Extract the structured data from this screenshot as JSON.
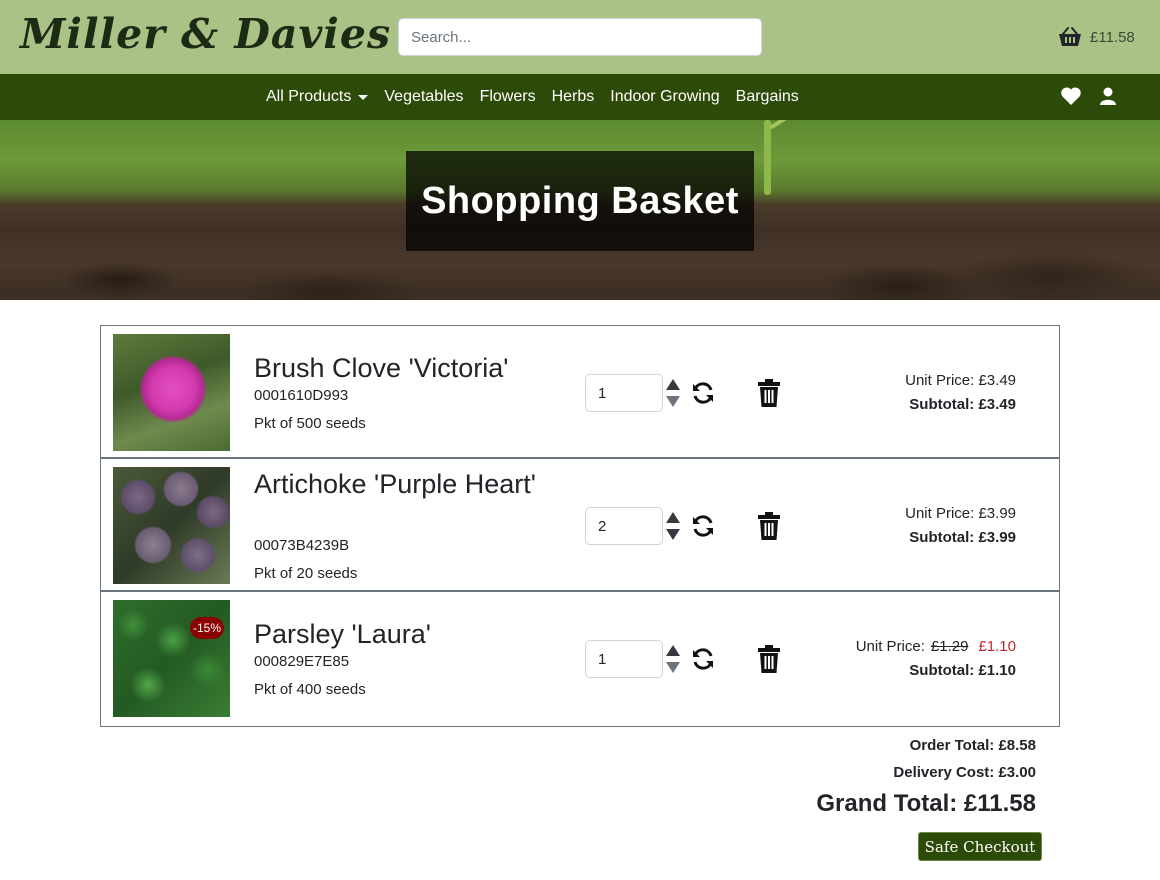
{
  "header": {
    "brand": "Miller & Davies",
    "search_placeholder": "Search...",
    "basket_total": "£11.58",
    "basket_icon": "basket-icon"
  },
  "nav": {
    "items": [
      {
        "label": "All Products",
        "dropdown": true
      },
      {
        "label": "Vegetables"
      },
      {
        "label": "Flowers"
      },
      {
        "label": "Herbs"
      },
      {
        "label": "Indoor Growing"
      },
      {
        "label": "Bargains"
      }
    ],
    "icons": [
      "heart-icon",
      "user-icon"
    ]
  },
  "hero": {
    "title": "Shopping Basket"
  },
  "items": [
    {
      "name": "Brush Clove 'Victoria'",
      "sku": "0001610D993",
      "pack": "Pkt of 500 seeds",
      "quantity": "1",
      "unit_price_label": "Unit Price: £3.49",
      "subtotal": "Subtotal: £3.49"
    },
    {
      "name": "Artichoke 'Purple Heart'",
      "sku": "00073B4239B",
      "pack": "Pkt of 20 seeds",
      "quantity": "2",
      "unit_price_label": "Unit Price: £3.99",
      "subtotal": "Subtotal: £3.99"
    },
    {
      "name": "Parsley 'Laura'",
      "sku": "000829E7E85",
      "pack": "Pkt of 400 seeds",
      "quantity": "1",
      "badge": "-15%",
      "unit_price_prefix": "Unit Price:",
      "old_price": "£1.29",
      "new_price": "£1.10",
      "subtotal": "Subtotal: £1.10"
    }
  ],
  "totals": {
    "order_total": "Order Total: £8.58",
    "delivery": "Delivery Cost: £3.00",
    "grand_total": "Grand Total: £11.58"
  },
  "checkout_label": "Safe Checkout",
  "colors": {
    "header_bg": "#abc287",
    "nav_bg": "#2c4a08",
    "sale_price": "#c0282d",
    "badge_bg": "#8b0000"
  }
}
